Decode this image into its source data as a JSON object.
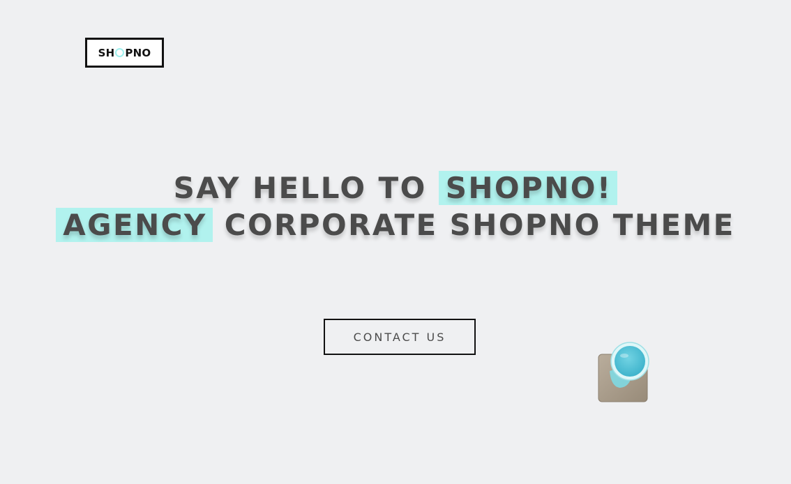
{
  "header": {
    "logo_text_before": "SH",
    "logo_text_after": "PNO"
  },
  "hero": {
    "line1_prefix": "SAY HELLO TO ",
    "line1_highlight": "SHOPNO!",
    "line2_highlight": "AGENCY",
    "line2_suffix": " CORPORATE SHOPNO THEME"
  },
  "cta": {
    "label": "CONTACT US"
  },
  "colors": {
    "background": "#eff0f2",
    "highlight": "#b1f2ee",
    "heading": "#4b4b4b",
    "border": "#111111",
    "accent": "#9ff0ee"
  },
  "icons": {
    "logo_o": "ring-icon",
    "decoration": "cup-on-coaster-icon"
  }
}
